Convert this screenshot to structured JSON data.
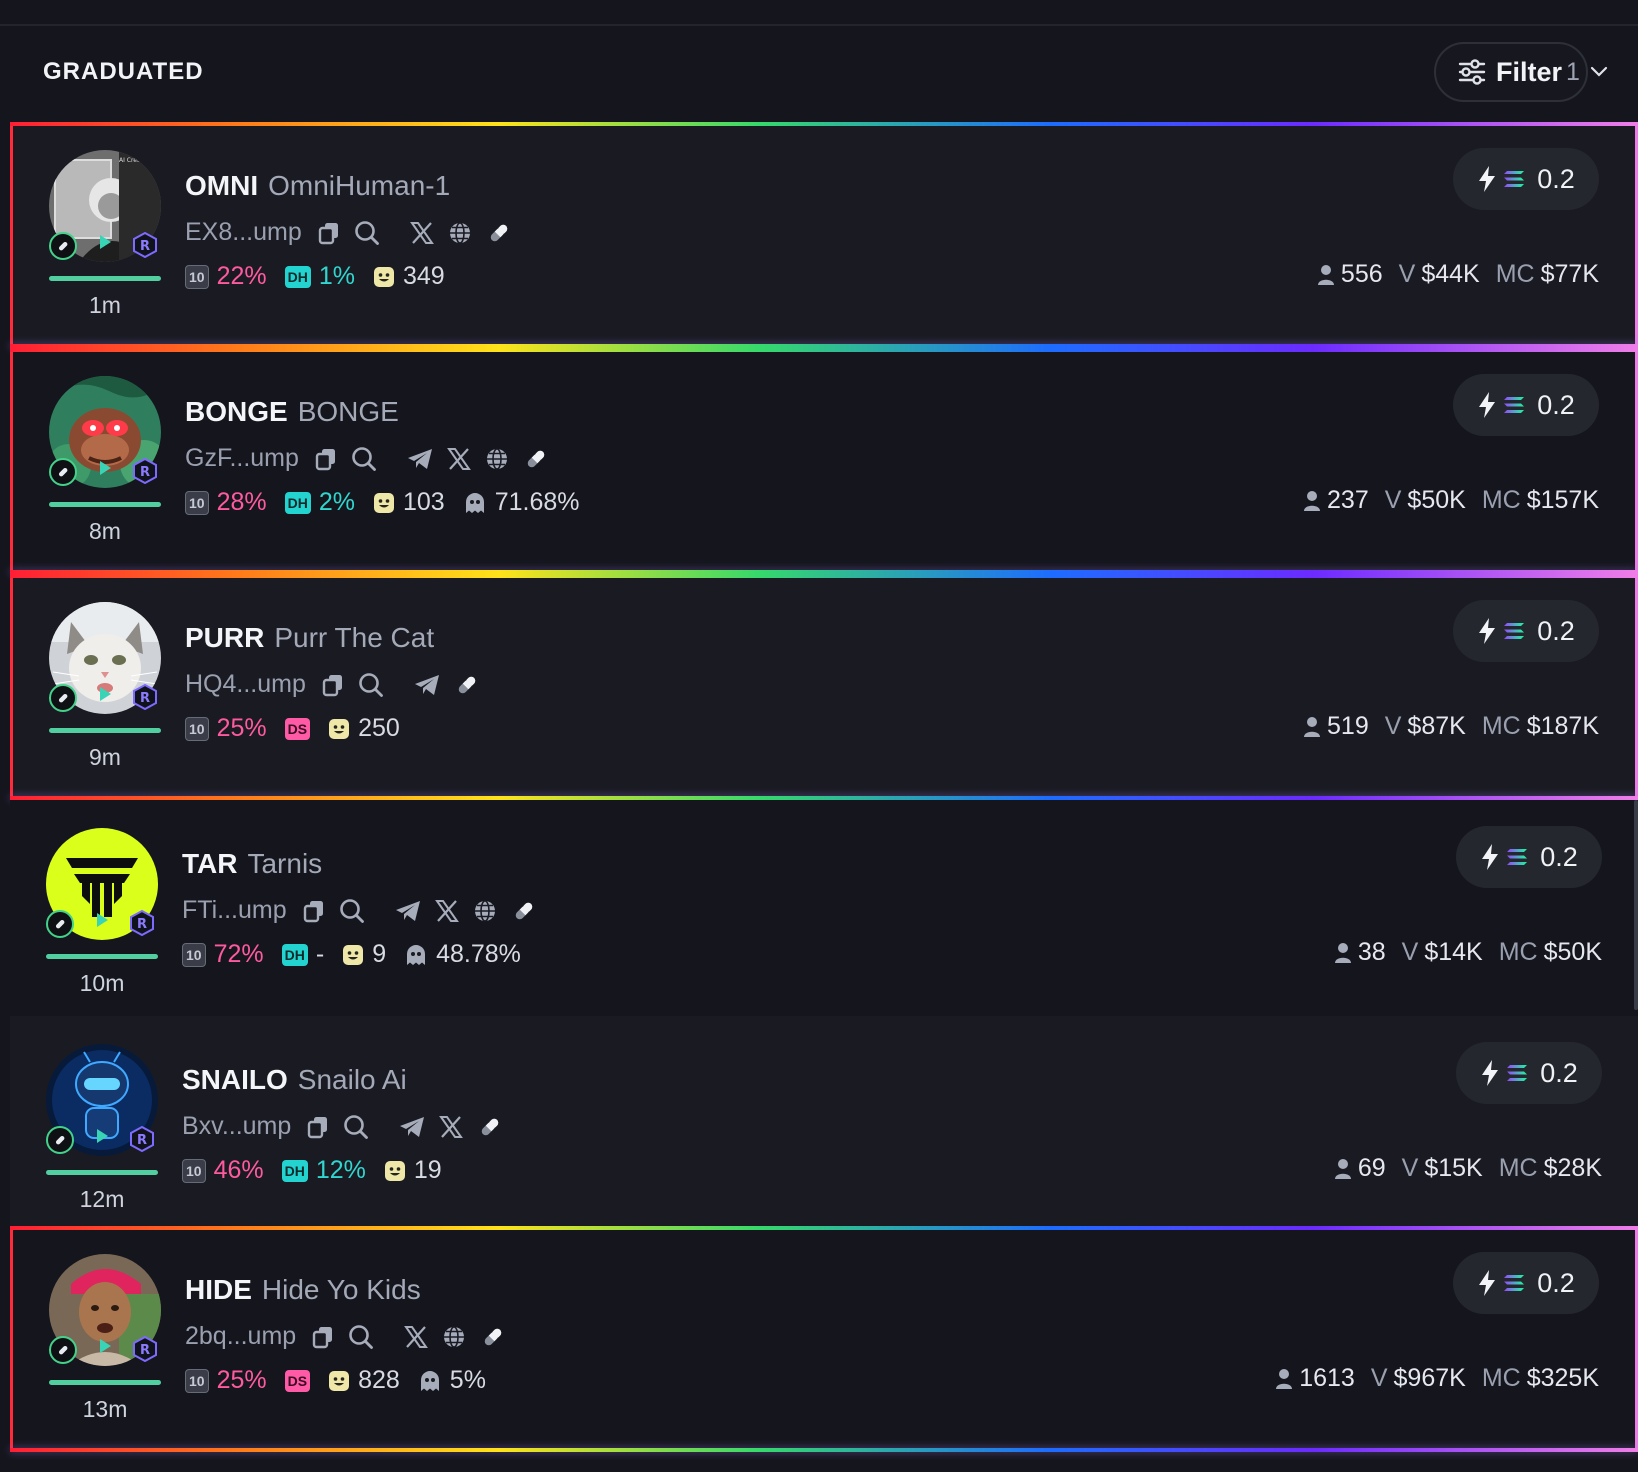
{
  "header": {
    "title": "GRADUATED",
    "filter_label": "Filter",
    "filter_count": "1"
  },
  "colors": {
    "pink": "#ff5aa0",
    "teal": "#30d6cf",
    "mc_orange": "#ffb17a",
    "mc_green": "#3ee0a0",
    "mc_teal": "#62d8ec"
  },
  "tokens": [
    {
      "ticker": "OMNI",
      "name": "OmniHuman-1",
      "address": "EX8...ump",
      "age": "1m",
      "buy_amount": "0.2",
      "socials": [
        "x-icon",
        "globe-icon",
        "pill-icon"
      ],
      "top10": "22%",
      "dev_badge": "DH",
      "dev_pct": "1%",
      "holders_badge": "349",
      "snipers": "",
      "holders": "556",
      "volume": "$44K",
      "mc": "$77K",
      "mc_color": "orange",
      "avatar": "photo-einstein",
      "highlighted": true
    },
    {
      "ticker": "BONGE",
      "name": "BONGE",
      "address": "GzF...ump",
      "age": "8m",
      "buy_amount": "0.2",
      "socials": [
        "telegram-icon",
        "x-icon",
        "globe-icon",
        "pill-icon"
      ],
      "top10": "28%",
      "dev_badge": "DH",
      "dev_pct": "2%",
      "holders_badge": "103",
      "snipers": "71.68%",
      "holders": "237",
      "volume": "$50K",
      "mc": "$157K",
      "mc_color": "green",
      "avatar": "frog-jungle",
      "highlighted": true
    },
    {
      "ticker": "PURR",
      "name": "Purr The Cat",
      "address": "HQ4...ump",
      "age": "9m",
      "buy_amount": "0.2",
      "socials": [
        "telegram-icon",
        "pill-icon"
      ],
      "top10": "25%",
      "dev_badge": "DS",
      "dev_pct": "",
      "holders_badge": "250",
      "snipers": "",
      "holders": "519",
      "volume": "$87K",
      "mc": "$187K",
      "mc_color": "green",
      "avatar": "cat",
      "highlighted": true
    },
    {
      "ticker": "TAR",
      "name": "Tarnis",
      "address": "FTi...ump",
      "age": "10m",
      "buy_amount": "0.2",
      "socials": [
        "telegram-icon",
        "x-icon",
        "globe-icon",
        "pill-icon"
      ],
      "top10": "72%",
      "dev_badge": "DH",
      "dev_pct": "-",
      "holders_badge": "9",
      "snipers": "48.78%",
      "holders": "38",
      "volume": "$14K",
      "mc": "$50K",
      "mc_color": "orange",
      "avatar": "tarnis-logo",
      "highlighted": false
    },
    {
      "ticker": "SNAILO",
      "name": "Snailo Ai",
      "address": "Bxv...ump",
      "age": "12m",
      "buy_amount": "0.2",
      "socials": [
        "telegram-icon",
        "x-icon",
        "pill-icon"
      ],
      "top10": "46%",
      "dev_badge": "DH",
      "dev_pct": "12%",
      "holders_badge": "19",
      "snipers": "",
      "holders": "69",
      "volume": "$15K",
      "mc": "$28K",
      "mc_color": "teal",
      "avatar": "robot-blue",
      "highlighted": false
    },
    {
      "ticker": "HIDE",
      "name": "Hide Yo Kids",
      "address": "2bq...ump",
      "age": "13m",
      "buy_amount": "0.2",
      "socials": [
        "x-icon",
        "globe-icon",
        "pill-icon"
      ],
      "top10": "25%",
      "dev_badge": "DS",
      "dev_pct": "",
      "holders_badge": "828",
      "snipers": "5%",
      "holders": "1613",
      "volume": "$967K",
      "mc": "$325K",
      "mc_color": "green",
      "avatar": "person-bandana",
      "highlighted": true
    }
  ],
  "labels": {
    "volume_prefix": "V",
    "mc_prefix": "MC"
  }
}
